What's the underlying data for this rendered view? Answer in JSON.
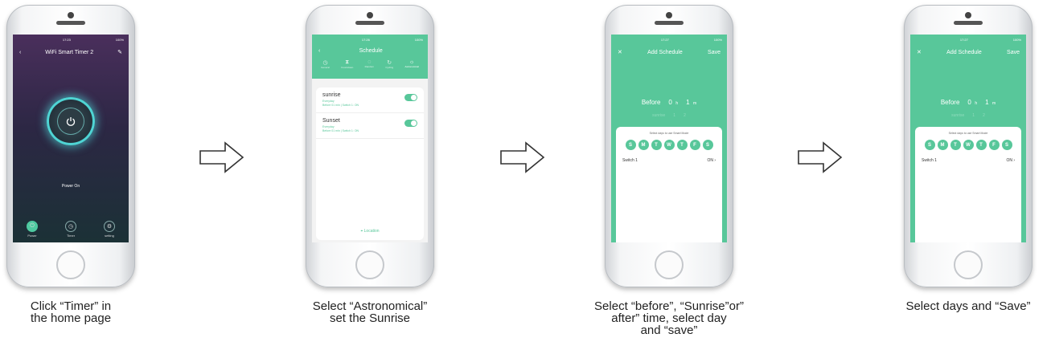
{
  "phone1": {
    "time": "17:23",
    "battery": "100%",
    "title": "WiFi Smart Timer 2",
    "status": "Power On",
    "tabs": [
      "Power",
      "Timer",
      "setting"
    ]
  },
  "phone2": {
    "time": "17:26",
    "battery": "100%",
    "title": "Schedule",
    "tabs": [
      "General",
      "Countdown",
      "Random",
      "Cycling",
      "Astronomical"
    ],
    "items": [
      {
        "name": "sunrise",
        "repeat": "Everyday",
        "detail": "Before 01 min | Switch 1: ON"
      },
      {
        "name": "Sunset",
        "repeat": "Everyday",
        "detail": "Before 01 min | Switch 1: ON"
      }
    ],
    "location": "Location"
  },
  "phone3": {
    "time": "17:27",
    "battery": "100%",
    "title": "Add Schedule",
    "save": "Save",
    "picker": {
      "mode": "Before",
      "hours": "0",
      "h_unit": "h",
      "minutes": "1",
      "m_unit": "m"
    },
    "picker_next": {
      "mode": "sunrise",
      "hours": "1",
      "minutes": "2"
    },
    "hint": "Select days to use Smart Mode",
    "days": [
      "S",
      "M",
      "T",
      "W",
      "T",
      "F",
      "S"
    ],
    "switch_label": "Switch 1",
    "switch_value": "ON"
  },
  "phone4": {
    "time": "17:27",
    "battery": "100%",
    "title": "Add Schedule",
    "save": "Save",
    "picker": {
      "mode": "Before",
      "hours": "0",
      "h_unit": "h",
      "minutes": "1",
      "m_unit": "m"
    },
    "picker_next": {
      "mode": "sunrise",
      "hours": "1",
      "minutes": "2"
    },
    "hint": "Select days to use Smart Mode",
    "days": [
      "S",
      "M",
      "T",
      "W",
      "T",
      "F",
      "S"
    ],
    "switch_label": "Switch 1",
    "switch_value": "ON"
  },
  "captions": {
    "c1_line1": "Click “Timer” in",
    "c1_line2": "the home page",
    "c2_line1": "Select “Astronomical”",
    "c2_line2": "set the Sunrise",
    "c3_line1": "Select “before”, “Sunrise”or”",
    "c3_line2": "after” time, select day",
    "c3_line3": "and “save”",
    "c4_line1": "Select days and “Save”"
  },
  "colors": {
    "accent": "#58c79a",
    "glow": "#4fd4d4"
  }
}
